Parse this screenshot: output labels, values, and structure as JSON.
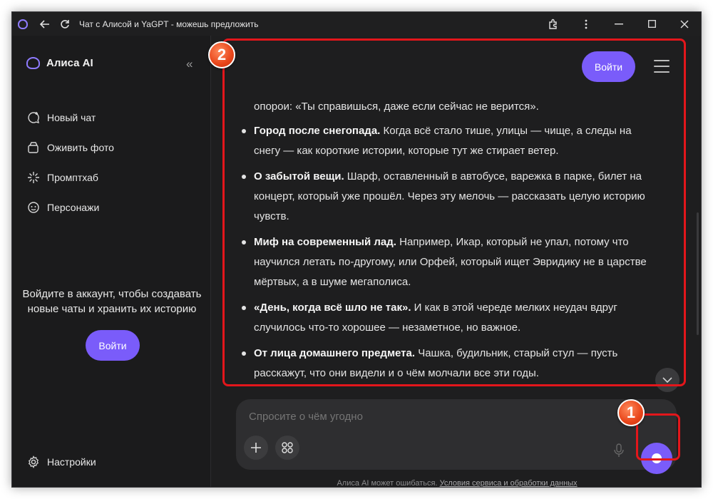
{
  "window": {
    "title": "Чат с Алисой и YaGPT - можешь предложить"
  },
  "sidebar": {
    "brand": "Алиса AI",
    "items": [
      {
        "label": "Новый чат",
        "icon": "chat-plus-icon"
      },
      {
        "label": "Оживить фото",
        "icon": "photo-animate-icon"
      },
      {
        "label": "Промптхаб",
        "icon": "sparkle-icon"
      },
      {
        "label": "Персонажи",
        "icon": "mask-icon"
      }
    ],
    "login_prompt": "Войдите в аккаунт, чтобы создавать новые чаты и хранить их историю",
    "login_button": "Войти",
    "settings": "Настройки"
  },
  "header": {
    "login_button": "Войти"
  },
  "chat": {
    "cut_line": "опорои: «Ты справишься, даже если сейчас не верится».",
    "bullets": [
      {
        "bold": "Город после снегопада.",
        "text": " Когда всё стало тише, улицы — чище, а следы на снегу — как короткие истории, которые тут же стирает ветер."
      },
      {
        "bold": "О забытой вещи.",
        "text": " Шарф, оставленный в автобусе, варежка в парке, билет на концерт, который уже прошёл. Через эту мелочь — рассказать целую историю чувств."
      },
      {
        "bold": "Миф на современный лад.",
        "text": " Например, Икар, который не упал, потому что научился летать по-другому, или Орфей, который ищет Эвридику не в царстве мёртвых, а в шуме мегаполиса."
      },
      {
        "bold": "«День, когда всё шло не так».",
        "text": " И как в этой череде мелких неудач вдруг случилось что-то хорошее — незаметное, но важное."
      },
      {
        "bold": "От лица домашнего предмета.",
        "text": " Чашка, будильник, старый стул — пусть расскажут, что они видели и о чём молчали все эти годы."
      }
    ]
  },
  "input": {
    "placeholder": "Спросите о чём угодно"
  },
  "footer": {
    "text": "Алиса AI может ошибаться. ",
    "link": "Условия сервиса и обработки данных"
  },
  "annotations": {
    "badge_1": "1",
    "badge_2": "2",
    "color": "#e3161b"
  },
  "colors": {
    "accent": "#7a5cfa",
    "background": "#1e1e1f"
  }
}
